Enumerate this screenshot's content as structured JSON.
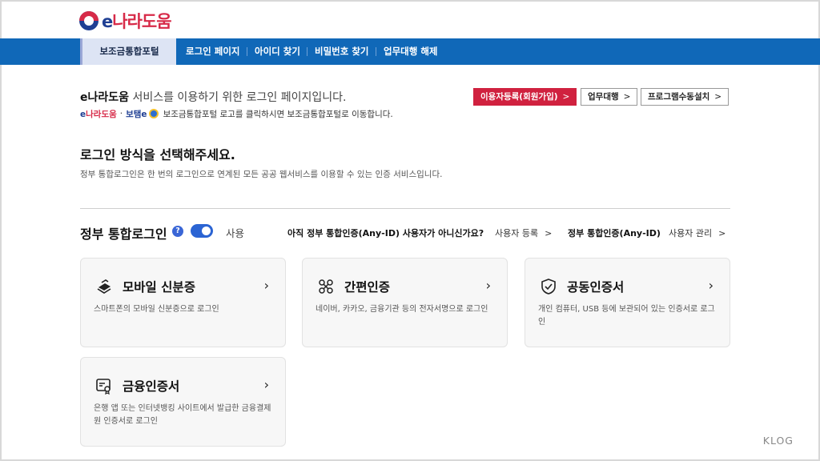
{
  "logo": {
    "prefix": "e",
    "name": "나라도움"
  },
  "nav": {
    "items": [
      "보조금통합포털",
      "로그인 페이지",
      "아이디 찾기",
      "비밀번호 찾기",
      "업무대행 해제"
    ]
  },
  "intro": {
    "brand": "e나라도움",
    "text": " 서비스를 이용하기 위한 로그인 페이지입니다.",
    "sub_brand1_prefix": "e",
    "sub_brand1": "나라도움",
    "sub_sep": "·",
    "sub_brand2": "보탬e",
    "sub_text": "보조금통합포털 로고를 클릭하시면 보조금통합포털로 이동합니다."
  },
  "buttons": {
    "register": "이용자등록(회원가입)",
    "proxy": "업무대행",
    "install": "프로그램수동설치",
    "chevron": ">"
  },
  "select": {
    "heading": "로그인 방식을 선택해주세요.",
    "description": "정부 통합로그인은 한 번의 로그인으로 연계된 모든 공공 웹서비스를 이용할 수 있는 인증 서비스입니다."
  },
  "gov_login": {
    "title": "정부 통합로그인",
    "help": "?",
    "toggle_label": "사용",
    "toggle_on": true,
    "question": "아직 정부 통합인증(Any-ID) 사용자가 아니신가요?",
    "register_link": "사용자 등록",
    "anyid_title": "정부 통합인증(Any-ID)",
    "manage_link": "사용자 관리",
    "chevron": ">"
  },
  "cards": [
    {
      "title": "모바일 신분증",
      "desc": "스마트폰의 모바일 신분증으로 로그인",
      "icon": "id-card-stack-icon"
    },
    {
      "title": "간편인증",
      "desc": "네이버, 카카오, 금융기관 등의 전자서명으로 로그인",
      "icon": "simple-auth-icon"
    },
    {
      "title": "공동인증서",
      "desc": "개인 컴퓨터, USB 등에 보관되어 있는 인증서로 로그인",
      "icon": "shield-check-icon"
    },
    {
      "title": "금융인증서",
      "desc": "은행 앱 또는 인터넷뱅킹 사이트에서 발급한 금융결제원 인증서로 로그인",
      "icon": "certificate-icon"
    }
  ],
  "watermark": "KLOG",
  "colors": {
    "nav_blue": "#1068b8",
    "accent_red": "#d0213f",
    "toggle_blue": "#2b64d3"
  }
}
